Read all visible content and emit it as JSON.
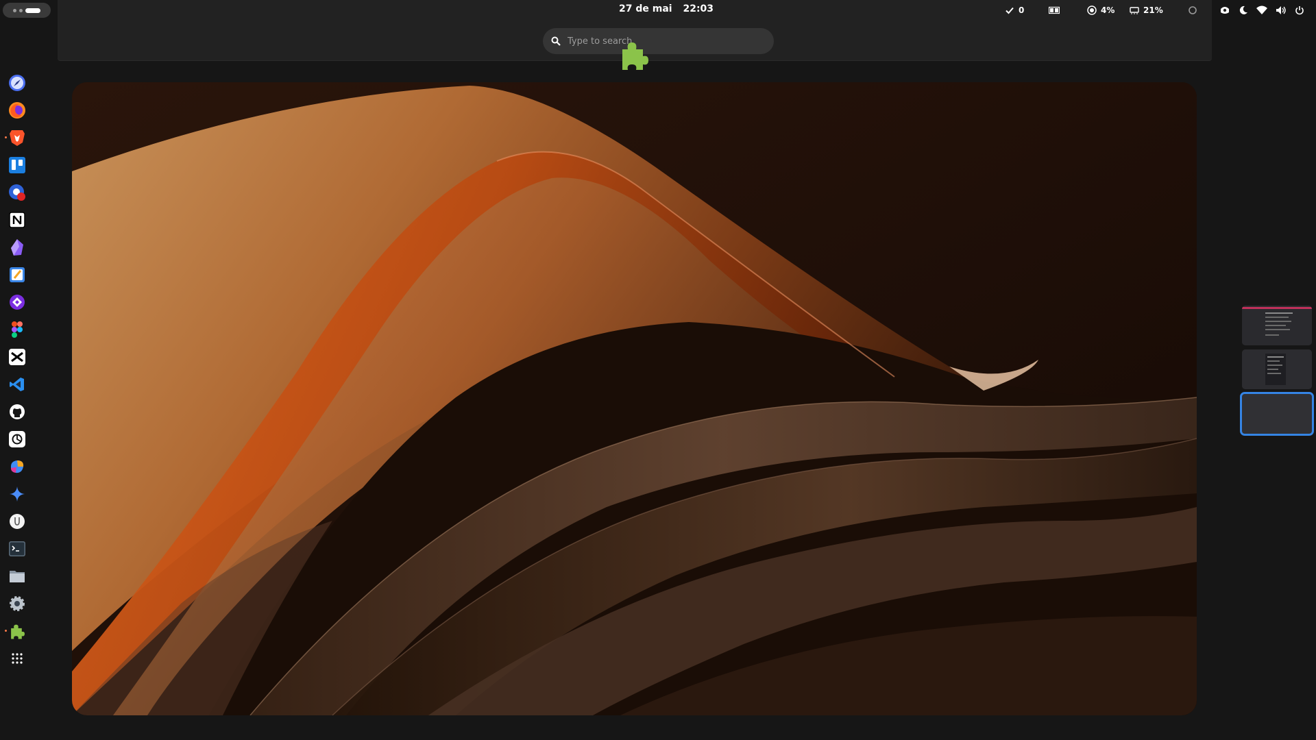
{
  "top_bar": {
    "date": "27 de mai",
    "time": "22:03",
    "tasks_count": "0",
    "cpu_percent": "4%",
    "memory_percent": "21%"
  },
  "search": {
    "placeholder": "Type to search"
  },
  "dock": {
    "apps": [
      {
        "name": "safari-like-browser",
        "icon": "compass-icon",
        "color": "#4a6ef0"
      },
      {
        "name": "firefox",
        "icon": "firefox-icon",
        "color": "#ff6a1f"
      },
      {
        "name": "brave",
        "icon": "brave-lion-icon",
        "color": "#fb542b",
        "running": true
      },
      {
        "name": "trello",
        "icon": "trello-icon",
        "color": "#1b7fe0"
      },
      {
        "name": "screen-recorder",
        "icon": "record-icon",
        "color": "#2f62d8"
      },
      {
        "name": "notion",
        "icon": "notion-icon",
        "color": "#ffffff"
      },
      {
        "name": "obsidian",
        "icon": "obsidian-icon",
        "color": "#8a5cf5"
      },
      {
        "name": "text-editor",
        "icon": "notepad-icon",
        "color": "#3a85e6"
      },
      {
        "name": "kdenlive-like",
        "icon": "diamond-icon",
        "color": "#7b2ee0"
      },
      {
        "name": "figma",
        "icon": "figma-icon",
        "color": "#f24e1e"
      },
      {
        "name": "capcut",
        "icon": "capcut-icon",
        "color": "#ffffff"
      },
      {
        "name": "vscode",
        "icon": "vscode-icon",
        "color": "#2a8ff0"
      },
      {
        "name": "github",
        "icon": "github-icon",
        "color": "#ffffff"
      },
      {
        "name": "chatgpt",
        "icon": "openai-icon",
        "color": "#ffffff"
      },
      {
        "name": "copilot",
        "icon": "copilot-icon",
        "color": "#3f8cf5"
      },
      {
        "name": "gemini",
        "icon": "sparkle-icon",
        "color": "#4a8cf7"
      },
      {
        "name": "ollama",
        "icon": "llama-icon",
        "color": "#ffffff"
      },
      {
        "name": "terminal",
        "icon": "terminal-icon",
        "color": "#6a7b8a"
      },
      {
        "name": "files",
        "icon": "folder-icon",
        "color": "#aab4c0"
      },
      {
        "name": "settings",
        "icon": "gear-icon",
        "color": "#bcc4cc"
      },
      {
        "name": "extensions",
        "icon": "puzzle-icon",
        "color": "#8bc34a",
        "running": true
      },
      {
        "name": "app-grid",
        "icon": "grid-icon",
        "color": "#ffffff"
      }
    ]
  },
  "accent_color": "#3584e4",
  "workspaces": {
    "count": 3,
    "active_index": 2
  }
}
